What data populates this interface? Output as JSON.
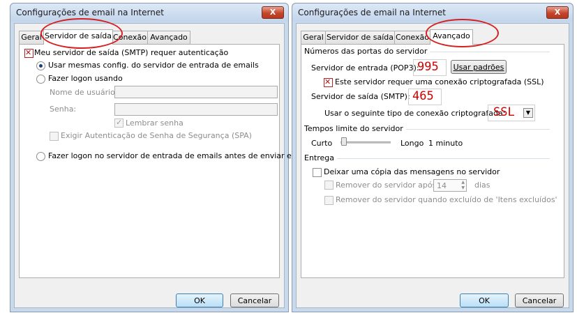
{
  "left": {
    "title": "Configurações de email na Internet",
    "close_glyph": "X",
    "tabs": [
      "Geral",
      "Servidor de saída",
      "Conexão",
      "Avançado"
    ],
    "smtp_auth_label": "Meu servidor de saída (SMTP) requer autenticação",
    "same_config_label": "Usar mesmas config. do servidor de entrada de emails",
    "logon_using_label": "Fazer logon usando",
    "username_label": "Nome de usuário:",
    "password_label": "Senha:",
    "remember_label": "Lembrar senha",
    "spa_label": "Exigir Autenticação de Senha de Segurança (SPA)",
    "logon_before_label": "Fazer logon no servidor de entrada de emails antes de enviar email",
    "ok": "OK",
    "cancel": "Cancelar"
  },
  "right": {
    "title": "Configurações de email na Internet",
    "close_glyph": "X",
    "tabs": [
      "Geral",
      "Servidor de saída",
      "Conexão",
      "Avançado"
    ],
    "ports_group": "Números das portas do servidor",
    "incoming_label": "Servidor de entrada (POP3):",
    "incoming_value": "995",
    "defaults_button": "Usar padrões",
    "ssl_required_label": "Este servidor requer uma conexão criptografada (SSL)",
    "outgoing_label": "Servidor de saída (SMTP):",
    "outgoing_value": "465",
    "encryption_label": "Usar o seguinte tipo de conexão criptografada:",
    "encryption_value": "SSL",
    "timeout_group": "Tempos limite do servidor",
    "timeout_short": "Curto",
    "timeout_long": "Longo",
    "timeout_value": "1 minuto",
    "delivery_group": "Entrega",
    "leave_copy_label": "Deixar uma cópia das mensagens no servidor",
    "remove_after_label": "Remover do servidor após",
    "remove_days_value": "14",
    "days_label": "dias",
    "remove_deleted_label": "Remover do servidor quando excluído de 'Itens excluídos'",
    "ok": "OK",
    "cancel": "Cancelar"
  },
  "colors": {
    "annotation": "#d62020",
    "checkbox_x": "#c01010"
  }
}
